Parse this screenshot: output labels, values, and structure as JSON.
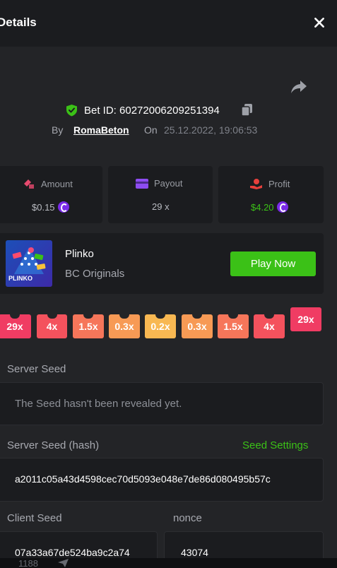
{
  "header": {
    "title": "Details"
  },
  "bet": {
    "label": "Bet ID: 60272006209251394"
  },
  "byline": {
    "by": "By",
    "user": "RomaBeton",
    "on": "On",
    "date": "25.12.2022, 19:06:53"
  },
  "stats": {
    "amount": {
      "label": "Amount",
      "value": "$0.15"
    },
    "payout": {
      "label": "Payout",
      "value": "29 x"
    },
    "profit": {
      "label": "Profit",
      "value": "$4.20"
    }
  },
  "game": {
    "name": "Plinko",
    "provider": "BC Originals",
    "play_label": "Play Now",
    "thumb_text": "PLINKO"
  },
  "multipliers": [
    "29x",
    "4x",
    "1.5x",
    "0.3x",
    "0.2x",
    "0.3x",
    "1.5x",
    "4x",
    "29x"
  ],
  "seeds": {
    "server_seed_label": "Server Seed",
    "server_seed_value": "The Seed hasn't been revealed yet.",
    "server_hash_label": "Server Seed (hash)",
    "seed_settings_label": "Seed Settings",
    "server_hash_value": "a2011c05a43d4598cec70d5093e048e7de86d080495b57c",
    "client_seed_label": "Client Seed",
    "client_seed_value": "07a33a67de524ba9c2a74",
    "nonce_label": "nonce",
    "nonce_value": "43074"
  },
  "footer": {
    "count": "1188"
  },
  "colors": {
    "accent_green": "#3bc117",
    "coin_purple": "#7a2be8",
    "multiplier_29x": "#f03c63",
    "multiplier_4x": "#f4525d",
    "multiplier_1_5x": "#f6765a",
    "multiplier_0_3x": "#f79a55",
    "multiplier_0_2x": "#f8b852"
  }
}
